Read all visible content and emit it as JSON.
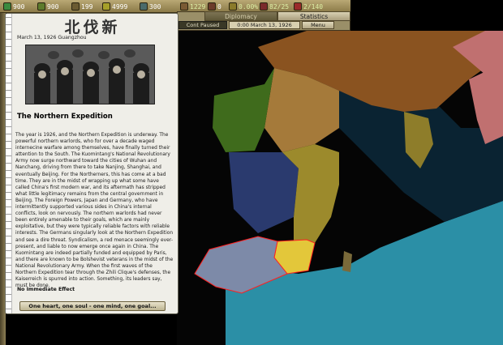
{
  "resources": [
    {
      "value": "900",
      "color": "#3b8a3f"
    },
    {
      "value": "900",
      "color": "#5d7b2c"
    },
    {
      "value": "199",
      "color": "#6b5b32"
    },
    {
      "value": "4999",
      "color": "#a6a02a"
    },
    {
      "value": "300",
      "color": "#4a6a6a"
    },
    {
      "value": "1229",
      "color": "#7a5a34"
    },
    {
      "value": "0",
      "color": "#6b3b2b"
    },
    {
      "value": "0.00%",
      "color": "#8a7a2a"
    },
    {
      "value": "82/25",
      "color": "#7a2b2b"
    },
    {
      "value": "2/140",
      "color": "#9a2a2a"
    }
  ],
  "tabs": [
    {
      "label": "Diplomacy",
      "active": true
    },
    {
      "label": "Statistics",
      "active": false
    }
  ],
  "speed_label": "Cont Paused",
  "game_date": "0:00 March 13, 1926",
  "menu_label": "Menu",
  "event": {
    "title": "北伐新",
    "date_location": "March 13, 1926 Guangzhou",
    "headline": "The Northern Expedition",
    "body": "The year is 1926, and the Northern Expedition is underway. The powerful northern warlords, who for over a decade waged internecine warfare among themselves, have finally turned their attention to the South. The Kuomintang's National Revolutionary Army now surge northward toward the cities of Wuhan and Nanchang, driving from there to take Nanjing, Shanghai, and eventually Beijing. For the Northerners, this has come at a bad time. They are in the midst of wrapping up what some have called China's first modern war, and its aftermath has stripped what little legitimacy remains from the central government in Beijing. The Foreign Powers, Japan and Germany, who have intermittently supported various sides in China's internal conflicts, look on nervously. The northern warlords had never been entirely amenable to their goals, which are mainly exploitative, but they were typically reliable factors with reliable interests. The Germans singularly look at the Northern Expedition and see a dire threat. Syndicalism, a red menace seemingly ever-present, and liable to now emerge once again in China. The Kuomintang are indeed partially funded and equipped by Paris, and there are known to be Bolshevist veterans in the midst of the National Revolutionary Army. When the first waves of the Northern Expedition tear through the Zhili Clique's defenses, the Kaiserreich is spurred into action. Something, its leaders say, must be done.",
    "effect": "No Immediate Effect",
    "option": "One heart, one soul - one mind, one goal..."
  },
  "map_regions": {
    "russia_brown": "#8a5320",
    "mongolia_sand": "#a57a3a",
    "manchuria_green": "#3f6b1c",
    "korea_olive": "#8e7d2a",
    "japan_pink": "#c07070",
    "northchina_navy": "#2a3a6e",
    "central_gold": "#9c8a2c",
    "kmt_yellow": "#e3c73a",
    "south_slate": "#7d8aa8",
    "sea_teal": "#2b8fa6",
    "land_black": "#000000"
  }
}
